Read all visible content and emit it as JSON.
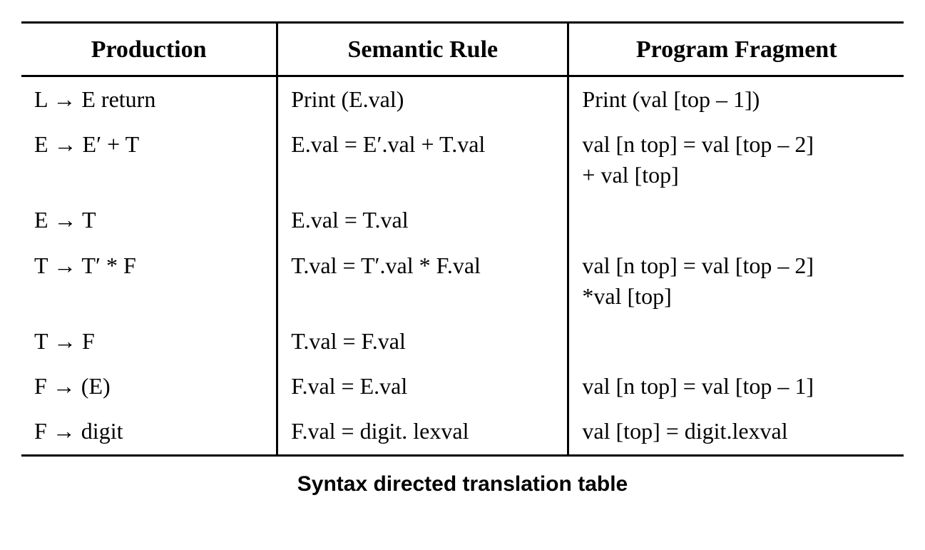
{
  "table": {
    "headers": {
      "production": "Production",
      "semantic": "Semantic Rule",
      "fragment": "Program Fragment"
    },
    "rows": [
      {
        "production": "L → E return",
        "semantic": "Print (E.val)",
        "fragment": "Print (val [top – 1])"
      },
      {
        "production": "E → E′ + T",
        "semantic": "E.val = E′.val + T.val",
        "fragment": "val [n top] = val [top – 2]\n+ val [top]"
      },
      {
        "production": "E → T",
        "semantic": "E.val = T.val",
        "fragment": ""
      },
      {
        "production": "T → T′ * F",
        "semantic": "T.val = T′.val  * F.val",
        "fragment": "val [n top] = val [top – 2]\n*val [top]"
      },
      {
        "production": "T → F",
        "semantic": "T.val = F.val",
        "fragment": ""
      },
      {
        "production": "F → (E)",
        "semantic": "F.val = E.val",
        "fragment": "val [n top] = val [top – 1]"
      },
      {
        "production": "F → digit",
        "semantic": "F.val = digit. lexval",
        "fragment": "val [top] = digit.lexval"
      }
    ],
    "caption": "Syntax directed translation table"
  }
}
